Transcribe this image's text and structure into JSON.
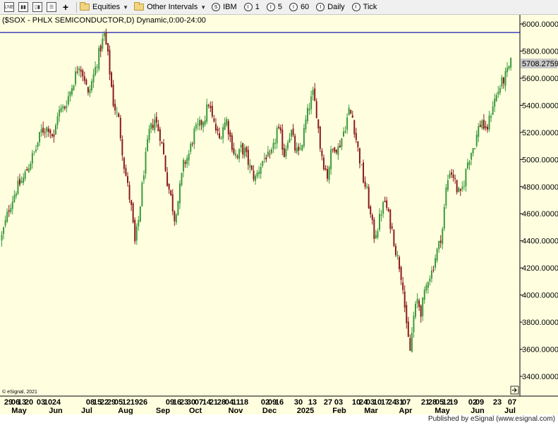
{
  "toolbar": {
    "icons": [
      "line-chart-icon",
      "bar-chart-icon",
      "candle-chart-icon",
      "settings-icon",
      "add-icon"
    ],
    "equities_label": "Equities",
    "intervals_label": "Other Intervals",
    "intervals": [
      {
        "label": "IBM",
        "icon": "clock-icon"
      },
      {
        "label": "1",
        "icon": "clock-icon"
      },
      {
        "label": "5",
        "icon": "clock-icon"
      },
      {
        "label": "60",
        "icon": "clock-icon"
      },
      {
        "label": "Daily",
        "icon": "clock-icon"
      },
      {
        "label": "Tick",
        "icon": "clock-icon"
      }
    ]
  },
  "chart_header": "($SOX - PHLX SEMICONDUCTOR,D) Dynamic,0:00-24:00",
  "copyright": "© eSignal, 2021",
  "publisher": "Published by eSignal (www.esignal.com)",
  "colors": {
    "background": "#ffffe0",
    "up": "#3a9a3a",
    "down": "#8b1a1a",
    "hline": "#1a1ab4",
    "price_tag": "#c8c8c8"
  },
  "chart_data": {
    "type": "candlestick",
    "title": "($SOX - PHLX SEMICONDUCTOR,D) Dynamic,0:00-24:00",
    "ylim": [
      3300,
      6070
    ],
    "y_ticks": [
      "6000.0000",
      "5800.0000",
      "5600.0000",
      "5400.0000",
      "5200.0000",
      "5000.0000",
      "4800.0000",
      "4600.0000",
      "4400.0000",
      "4200.0000",
      "4000.0000",
      "3800.0000",
      "3600.0000",
      "3400.0000"
    ],
    "last_price": "5708.2759",
    "horizontal_line": 5937,
    "x_day_labels": [
      "29",
      "06",
      "13",
      "20",
      "03",
      "10",
      "24",
      "08",
      "15",
      "22",
      "29",
      "05",
      "12",
      "19",
      "26",
      "09",
      "16",
      "23",
      "30",
      "07",
      "14",
      "21",
      "28",
      "04",
      "11",
      "18",
      "02",
      "09",
      "16",
      "30",
      "13",
      "27",
      "03",
      "10",
      "24",
      "03",
      "10",
      "17",
      "24",
      "31",
      "07",
      "21",
      "28",
      "05",
      "12",
      "19",
      "02",
      "09",
      "23",
      "07"
    ],
    "x_month_labels": [
      "May",
      "Jun",
      "Jul",
      "Aug",
      "Sep",
      "Oct",
      "Nov",
      "Dec",
      "2025",
      "Feb",
      "Mar",
      "Apr",
      "May",
      "Jun",
      "Jul"
    ],
    "close_path": [
      [
        0,
        4430
      ],
      [
        4,
        4640
      ],
      [
        8,
        4780
      ],
      [
        12,
        4860
      ],
      [
        16,
        4990
      ],
      [
        19,
        5080
      ],
      [
        22,
        5210
      ],
      [
        26,
        5240
      ],
      [
        29,
        5150
      ],
      [
        31,
        5340
      ],
      [
        35,
        5390
      ],
      [
        39,
        5540
      ],
      [
        43,
        5710
      ],
      [
        46,
        5600
      ],
      [
        48,
        5470
      ],
      [
        51,
        5620
      ],
      [
        54,
        5780
      ],
      [
        57,
        5920
      ],
      [
        59,
        5760
      ],
      [
        62,
        5420
      ],
      [
        65,
        5290
      ],
      [
        68,
        4960
      ],
      [
        70,
        4800
      ],
      [
        72,
        4640
      ],
      [
        74,
        4380
      ],
      [
        76,
        4550
      ],
      [
        79,
        4920
      ],
      [
        82,
        5200
      ],
      [
        85,
        5300
      ],
      [
        88,
        5180
      ],
      [
        90,
        5030
      ],
      [
        92,
        4840
      ],
      [
        94,
        4720
      ],
      [
        96,
        4570
      ],
      [
        98,
        4700
      ],
      [
        101,
        4960
      ],
      [
        104,
        5040
      ],
      [
        107,
        5200
      ],
      [
        110,
        5250
      ],
      [
        113,
        5320
      ],
      [
        115,
        5420
      ],
      [
        117,
        5300
      ],
      [
        119,
        5220
      ],
      [
        121,
        5150
      ],
      [
        123,
        5250
      ],
      [
        125,
        5290
      ],
      [
        127,
        5160
      ],
      [
        129,
        5060
      ],
      [
        131,
        5010
      ],
      [
        133,
        5080
      ],
      [
        135,
        5060
      ],
      [
        137,
        4980
      ],
      [
        139,
        4900
      ],
      [
        141,
        4860
      ],
      [
        143,
        4930
      ],
      [
        145,
        4990
      ],
      [
        147,
        5030
      ],
      [
        149,
        5000
      ],
      [
        151,
        5080
      ],
      [
        153,
        5220
      ],
      [
        155,
        5170
      ],
      [
        157,
        5040
      ],
      [
        159,
        5160
      ],
      [
        161,
        5200
      ],
      [
        163,
        5080
      ],
      [
        165,
        5030
      ],
      [
        167,
        5130
      ],
      [
        169,
        5280
      ],
      [
        171,
        5400
      ],
      [
        173,
        5480
      ],
      [
        175,
        5350
      ],
      [
        177,
        5100
      ],
      [
        179,
        4970
      ],
      [
        181,
        4880
      ],
      [
        183,
        5040
      ],
      [
        185,
        5100
      ],
      [
        187,
        5080
      ],
      [
        189,
        5160
      ],
      [
        191,
        5250
      ],
      [
        193,
        5360
      ],
      [
        195,
        5310
      ],
      [
        197,
        5150
      ],
      [
        199,
        5000
      ],
      [
        201,
        4850
      ],
      [
        203,
        4760
      ],
      [
        205,
        4580
      ],
      [
        207,
        4440
      ],
      [
        209,
        4500
      ],
      [
        211,
        4620
      ],
      [
        213,
        4690
      ],
      [
        215,
        4580
      ],
      [
        217,
        4480
      ],
      [
        219,
        4330
      ],
      [
        221,
        4220
      ],
      [
        223,
        4080
      ],
      [
        225,
        3750
      ],
      [
        227,
        3590
      ],
      [
        229,
        3840
      ],
      [
        231,
        3960
      ],
      [
        233,
        3880
      ],
      [
        235,
        4000
      ],
      [
        237,
        4130
      ],
      [
        239,
        4170
      ],
      [
        241,
        4280
      ],
      [
        243,
        4370
      ],
      [
        245,
        4490
      ],
      [
        247,
        4780
      ],
      [
        249,
        4920
      ],
      [
        251,
        4880
      ],
      [
        253,
        4780
      ],
      [
        255,
        4730
      ],
      [
        257,
        4840
      ],
      [
        259,
        4980
      ],
      [
        261,
        5060
      ],
      [
        263,
        5120
      ],
      [
        265,
        5230
      ],
      [
        267,
        5290
      ],
      [
        269,
        5190
      ],
      [
        271,
        5290
      ],
      [
        273,
        5410
      ],
      [
        275,
        5470
      ],
      [
        277,
        5540
      ],
      [
        279,
        5590
      ],
      [
        281,
        5640
      ],
      [
        283,
        5708
      ]
    ]
  }
}
